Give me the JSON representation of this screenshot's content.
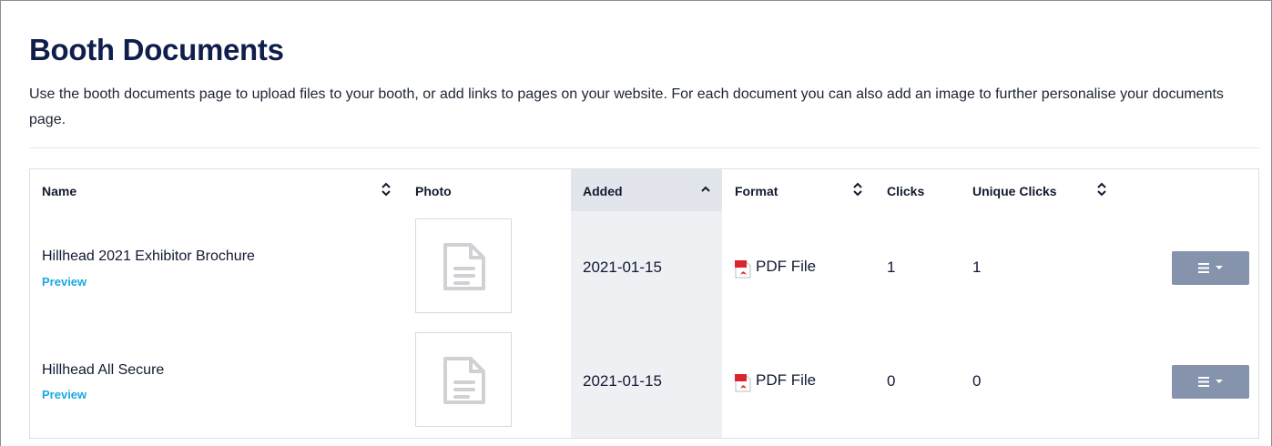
{
  "page": {
    "title": "Booth Documents",
    "description": "Use the booth documents page to upload files to your booth, or add links to pages on your website. For each document you can also add an image to further personalise your documents page."
  },
  "table": {
    "headers": {
      "name": "Name",
      "photo": "Photo",
      "added": "Added",
      "format": "Format",
      "clicks": "Clicks",
      "unique_clicks": "Unique Clicks"
    },
    "sort": {
      "active_column": "added",
      "direction": "ascending"
    },
    "rows": [
      {
        "name": "Hillhead 2021 Exhibitor Brochure",
        "preview": "Preview",
        "photo_icon": "document-placeholder-icon",
        "added": "2021-01-15",
        "format_icon": "pdf-file-icon",
        "format": "PDF File",
        "clicks": "1",
        "unique_clicks": "1",
        "action_icons": [
          "menu-icon",
          "caret-down-icon"
        ]
      },
      {
        "name": "Hillhead All Secure",
        "preview": "Preview",
        "photo_icon": "document-placeholder-icon",
        "added": "2021-01-15",
        "format_icon": "pdf-file-icon",
        "format": "PDF File",
        "clicks": "0",
        "unique_clicks": "0",
        "action_icons": [
          "menu-icon",
          "caret-down-icon"
        ]
      }
    ]
  },
  "colors": {
    "title": "#0f1e4b",
    "link": "#1aa9e0",
    "action_button": "#8593ad",
    "sorted_column": "#eef0f4",
    "pdf_red": "#d9262b"
  }
}
